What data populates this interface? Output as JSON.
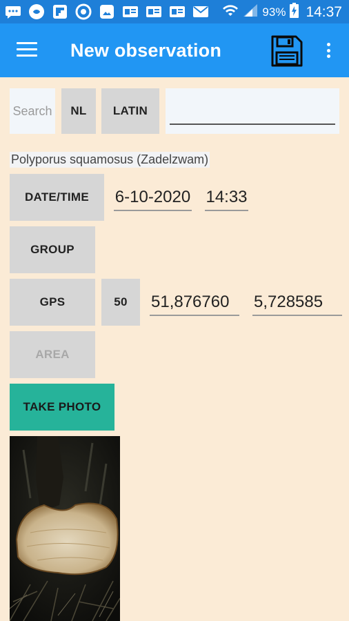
{
  "status_bar": {
    "battery_percent": "93%",
    "time": "14:37"
  },
  "app_bar": {
    "title": "New observation"
  },
  "language_row": {
    "search_label": "Search",
    "nl_label": "NL",
    "latin_label": "LATIN",
    "name_value": ""
  },
  "species_name": "Polyporus squamosus (Zadelzwam)",
  "datetime": {
    "button_label": "DATE/TIME",
    "date": "6-10-2020",
    "time": "14:33"
  },
  "group": {
    "button_label": "GROUP"
  },
  "gps": {
    "button_label": "GPS",
    "accuracy": "50",
    "latitude": "51,876760",
    "longitude": "5,728585"
  },
  "area": {
    "button_label": "AREA"
  },
  "photo": {
    "button_label": "TAKE PHOTO"
  },
  "colors": {
    "status_bar": "#1e7fd8",
    "app_bar": "#2196f3",
    "background": "#fbebd6",
    "button": "#d6d6d6",
    "accent": "#26b39a"
  }
}
